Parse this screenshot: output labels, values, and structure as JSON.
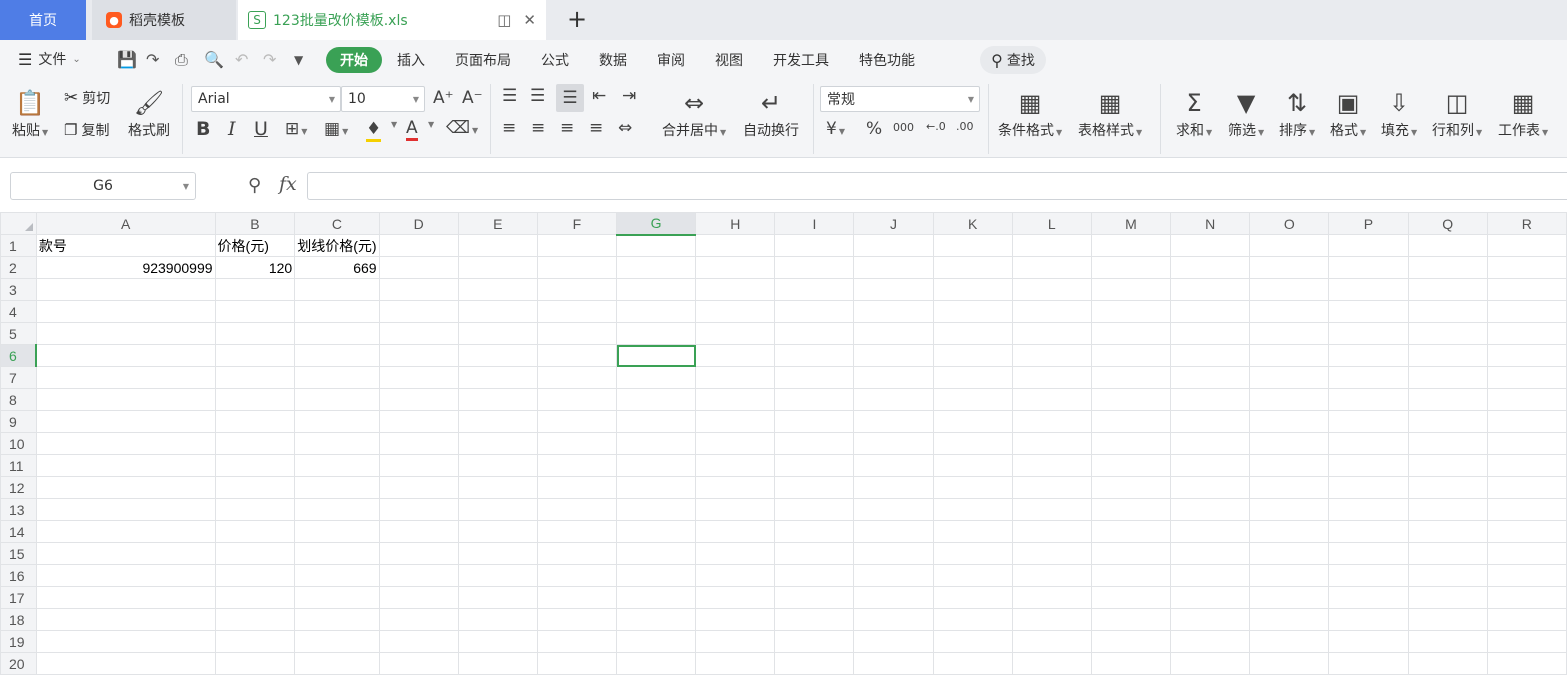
{
  "tabs": {
    "home": "首页",
    "daoke": "稻壳模板",
    "file": "123批量改价模板.xls"
  },
  "menu": {
    "file": "文件",
    "items": [
      "开始",
      "插入",
      "页面布局",
      "公式",
      "数据",
      "审阅",
      "视图",
      "开发工具",
      "特色功能"
    ],
    "search": "查找"
  },
  "ribbon": {
    "paste": "粘贴",
    "cut": "剪切",
    "copy": "复制",
    "format_painter": "格式刷",
    "font_name": "Arial",
    "font_size": "10",
    "merge_center": "合并居中",
    "wrap_text": "自动换行",
    "number_format": "常规",
    "conditional_format": "条件格式",
    "table_style": "表格样式",
    "sum": "求和",
    "filter": "筛选",
    "sort": "排序",
    "format": "格式",
    "fill": "填充",
    "rows_cols": "行和列",
    "worksheet": "工作表"
  },
  "formula_bar": {
    "cell_ref": "G6",
    "fx": "fx",
    "content": ""
  },
  "sheet": {
    "columns": [
      "A",
      "B",
      "C",
      "D",
      "E",
      "F",
      "G",
      "H",
      "I",
      "J",
      "K",
      "L",
      "M",
      "N",
      "O",
      "P",
      "Q",
      "R"
    ],
    "row_numbers": [
      "1",
      "2",
      "3",
      "4",
      "5",
      "6",
      "7",
      "8",
      "9",
      "10",
      "11",
      "12",
      "13",
      "14",
      "15",
      "16",
      "17",
      "18",
      "19",
      "20"
    ],
    "selected_cell": "G6",
    "cells": {
      "A1": "款号",
      "B1": "价格(元)",
      "C1": "划线价格(元)",
      "A2": "923900999",
      "B2": "120",
      "C2": "669"
    }
  },
  "colors": {
    "accent": "#3aa155",
    "home_tab": "#4f7de6"
  }
}
